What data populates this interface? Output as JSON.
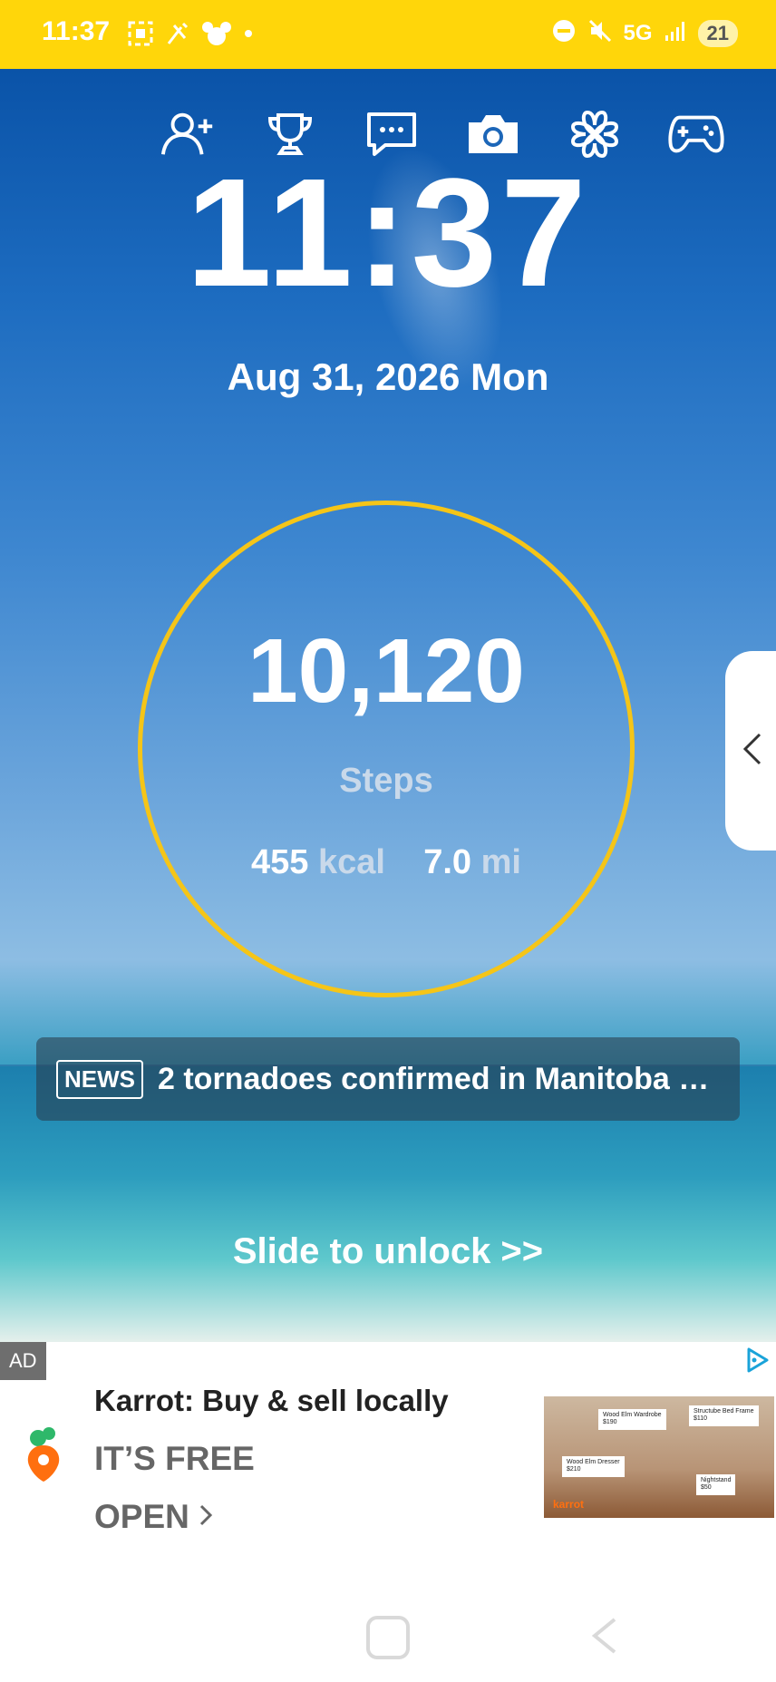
{
  "status_bar": {
    "time": "11:37",
    "network": "5G",
    "battery": "21",
    "icons_left": [
      "screenshot-icon",
      "tools-icon",
      "mouse-icon",
      "dot-icon"
    ],
    "icons_right": [
      "do-not-disturb-icon",
      "mute-icon",
      "signal-icon",
      "battery-icon"
    ]
  },
  "toolbar": {
    "icons": [
      "add-friend-icon",
      "trophy-icon",
      "chat-icon",
      "camera-icon",
      "clover-icon",
      "gamepad-icon"
    ]
  },
  "lockscreen": {
    "time": "11:37",
    "date": "Aug 31, 2026 Mon"
  },
  "steps": {
    "count": "10,120",
    "label": "Steps",
    "kcal_value": "455",
    "kcal_unit": "kcal",
    "distance_value": "7.0",
    "distance_unit": "mi"
  },
  "news": {
    "badge": "NEWS",
    "headline": "2 tornadoes confirmed in Manitoba a..."
  },
  "unlock": {
    "text": "Slide to unlock >>"
  },
  "ad": {
    "label": "AD",
    "title": "Karrot: Buy & sell locally",
    "subtitle": "IT’S FREE",
    "cta": "OPEN",
    "brand_color": "#FF6F0F",
    "image_cards": [
      {
        "name": "Wood Elm Wardrobe",
        "price": "$190"
      },
      {
        "name": "Structube Bed Frame",
        "price": "$110"
      },
      {
        "name": "Wood Elm Dresser",
        "price": "$210"
      },
      {
        "name": "Nightstand",
        "price": "$50"
      }
    ],
    "image_brand": "karrot"
  },
  "colors": {
    "status_bar": "#FFD60A",
    "ring": "#F5C518"
  }
}
